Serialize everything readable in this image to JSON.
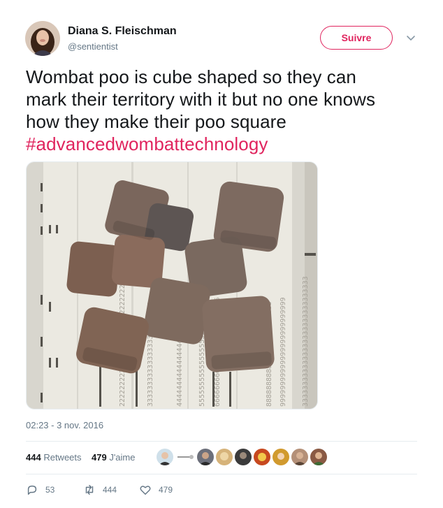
{
  "author": {
    "name": "Diana S. Fleischman",
    "handle": "@sentientist"
  },
  "follow_button": {
    "label": "Suivre"
  },
  "tweet": {
    "text_line1": "Wombat poo is cube shaped so they can",
    "text_line2": "mark their territory with it but no one knows",
    "text_line3": "how they make their poo square",
    "hashtag": "#advancedwombattechnology"
  },
  "timestamp": "02:23 - 3 nov. 2016",
  "stats": {
    "retweets_count": "444",
    "retweets_label": "Retweets",
    "likes_count": "479",
    "likes_label": "J'aime"
  },
  "actions": {
    "reply_count": "53",
    "retweet_count": "444",
    "like_count": "479"
  },
  "colors": {
    "accent": "#e0245e",
    "muted": "#657786",
    "text": "#14171a"
  },
  "icons": {
    "chevron": "chevron-down-icon",
    "reply": "reply-icon",
    "retweet": "retweet-icon",
    "like": "heart-icon"
  }
}
